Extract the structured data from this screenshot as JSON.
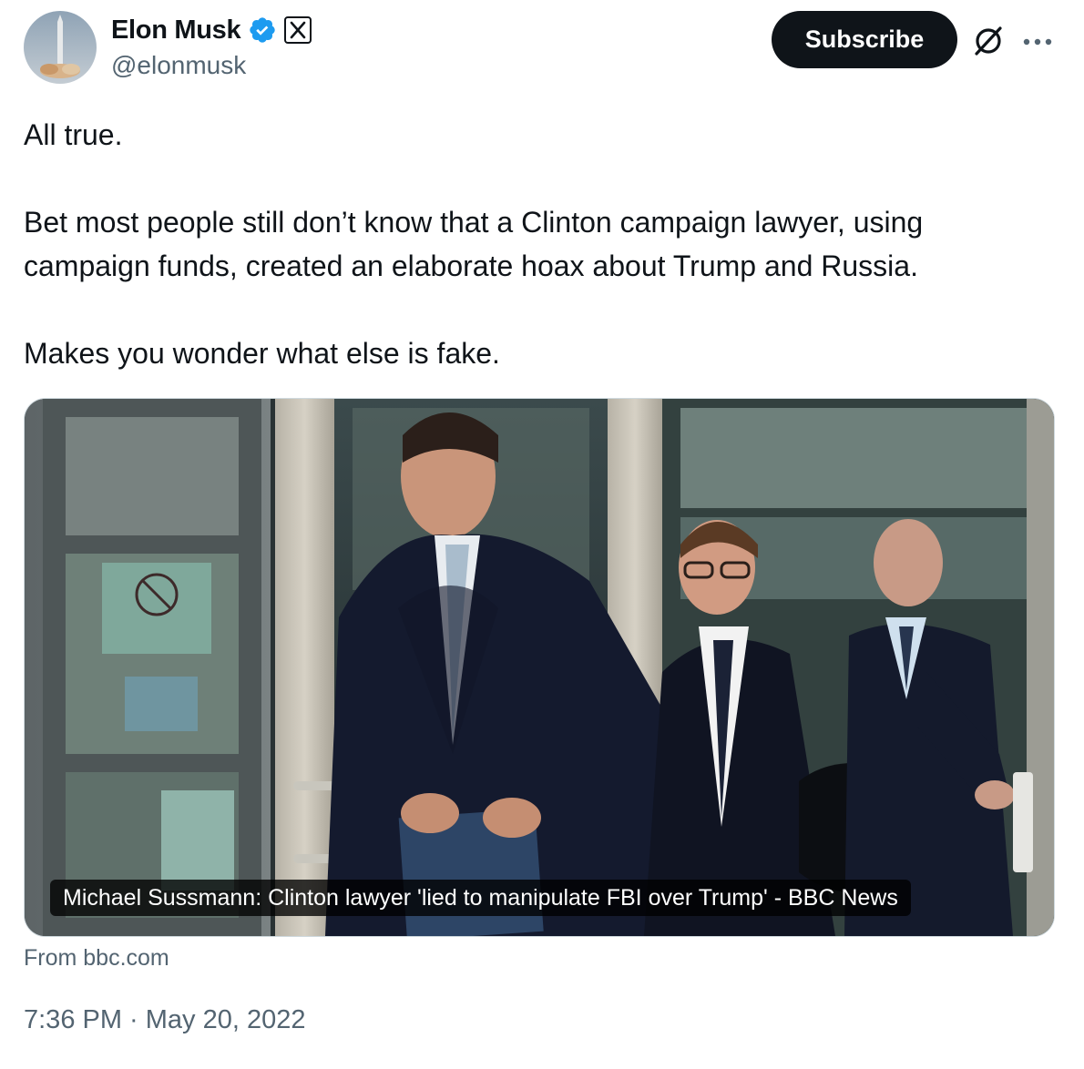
{
  "author": {
    "display_name": "Elon Musk",
    "handle": "@elonmusk",
    "verified": true,
    "affiliate_badge": "x-logo-icon",
    "avatar": "rocket-launch-avatar"
  },
  "actions": {
    "subscribe_label": "Subscribe",
    "grok_icon": "grok-icon",
    "more_icon": "more-dots-icon"
  },
  "tweet": {
    "paragraph_1": "All true.",
    "paragraph_2": "Bet most people still don’t know that a Clinton campaign lawyer, using campaign funds, created an elaborate hoax about Trump and Russia.",
    "paragraph_3": "Makes you wonder what else is fake."
  },
  "card": {
    "image": "three-men-exiting-courthouse-photo",
    "title": "Michael Sussmann: Clinton lawyer 'lied to manipulate FBI over Trump' - BBC News",
    "source": "From bbc.com"
  },
  "timestamp": "7:36 PM · May 20, 2022",
  "colors": {
    "primary_text": "#0f1419",
    "secondary_text": "#536471",
    "verified_blue": "#1d9bf0",
    "button_bg": "#0f1419",
    "border": "#cfd9de"
  }
}
